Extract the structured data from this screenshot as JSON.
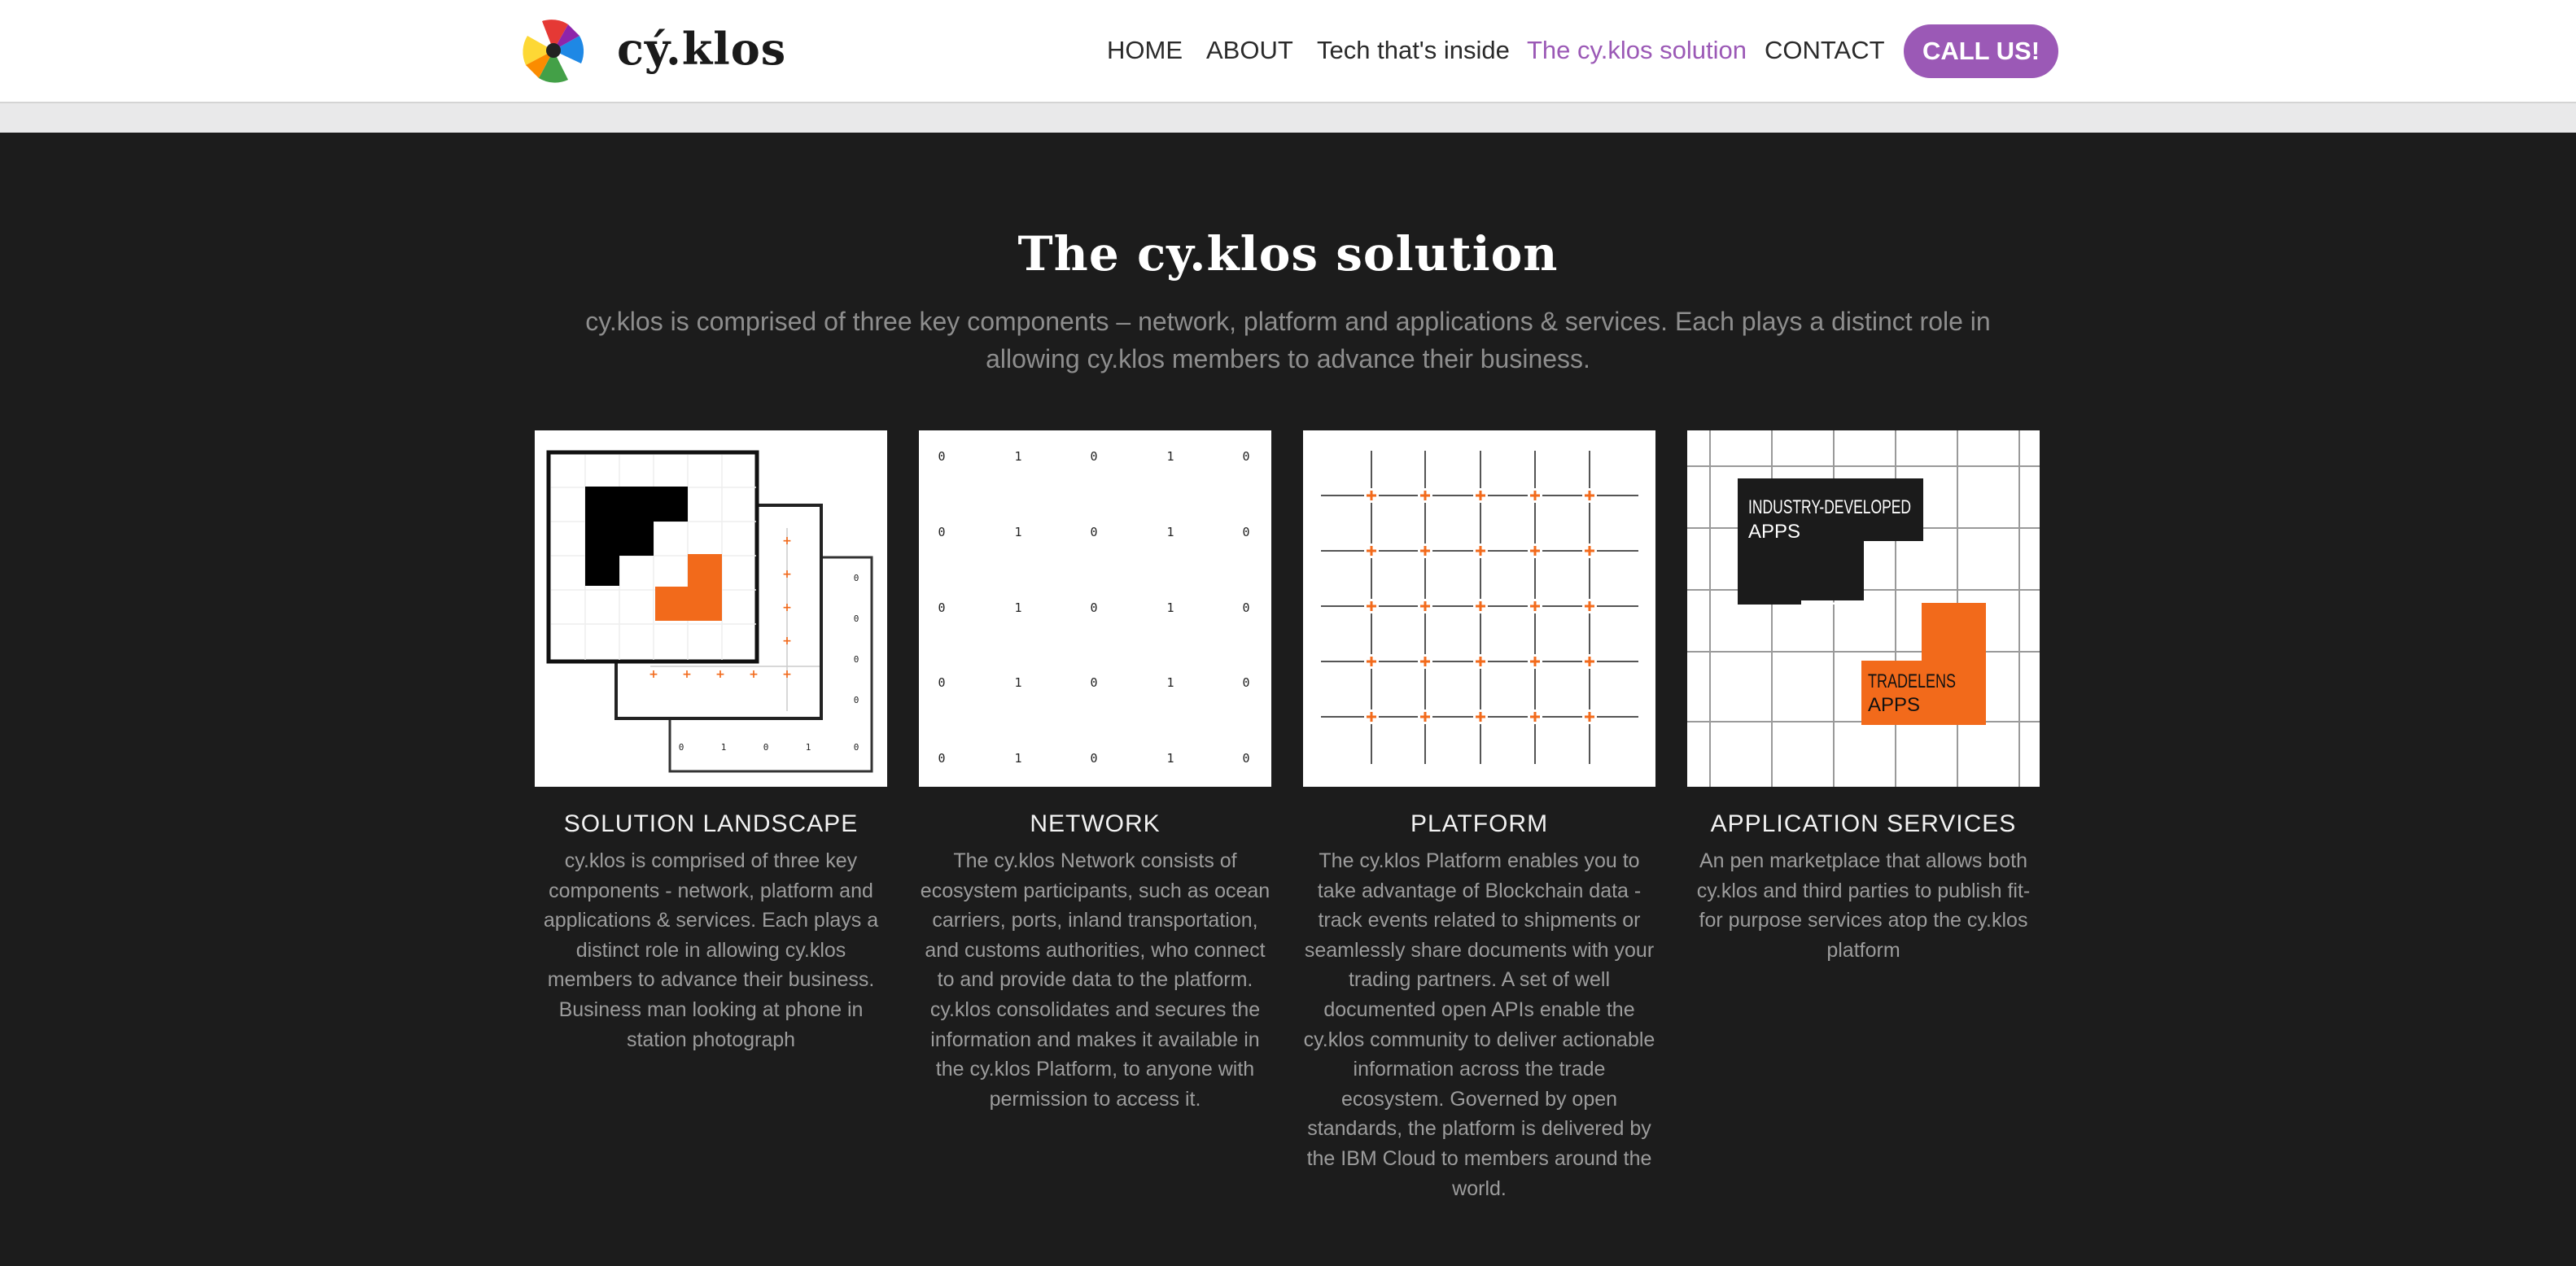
{
  "brand": {
    "name": "cý.klos",
    "logo_icon": "pinwheel-logo-icon"
  },
  "nav": {
    "items": [
      {
        "label": "HOME",
        "active": false
      },
      {
        "label": "ABOUT",
        "active": false
      },
      {
        "label": "Tech that's inside",
        "active": false
      },
      {
        "label": "The cy.klos solution",
        "active": true
      },
      {
        "label": "CONTACT",
        "active": false
      }
    ],
    "cta_label": "CALL US!"
  },
  "colors": {
    "accent": "#9b59b6",
    "orange": "#f26a1b",
    "dark_bg": "#1c1c1c",
    "header_bg": "#ffffff"
  },
  "section": {
    "title": "The cy.klos solution",
    "subtitle": "cy.klos is comprised of three key components – network, platform and applications & services. Each plays a distinct role in allowing cy.klos members to advance their business."
  },
  "cards": [
    {
      "title": "SOLUTION LANDSCAPE",
      "text": "cy.klos is comprised of three key components - network, platform and applications & services. Each plays a distinct role in allowing cy.klos members to advance their business. Business man looking at phone in station photograph",
      "image": {
        "small_tick_labels": [
          "0",
          "1",
          "0",
          "1",
          "0"
        ]
      }
    },
    {
      "title": "NETWORK",
      "text": "The cy.klos Network consists of ecosystem participants, such as ocean carriers, ports, inland transportation, and customs authorities, who connect to and provide data to the platform. cy.klos consolidates and secures the information and makes it available in the cy.klos Platform, to anyone with permission to access it.",
      "image": {
        "digit_columns": [
          "0",
          "1",
          "0",
          "1",
          "0"
        ]
      }
    },
    {
      "title": "PLATFORM",
      "text": "The cy.klos Platform enables you to take advantage of Blockchain data - track events related to shipments or seamlessly share documents with your trading partners. A set of well documented open APIs enable the cy.klos community to deliver actionable information across the trade ecosystem. Governed by open standards, the platform is delivered by the IBM Cloud to members around the world.",
      "image": {}
    },
    {
      "title": "APPLICATION SERVICES",
      "text": "An pen marketplace that allows both cy.klos and third parties to publish fit-for purpose services atop the cy.klos platform",
      "image": {
        "dark_label_line1": "INDUSTRY-DEVELOPED",
        "dark_label_line2": "APPS",
        "orange_label_line1": "TRADELENS",
        "orange_label_line2": "APPS"
      }
    }
  ]
}
